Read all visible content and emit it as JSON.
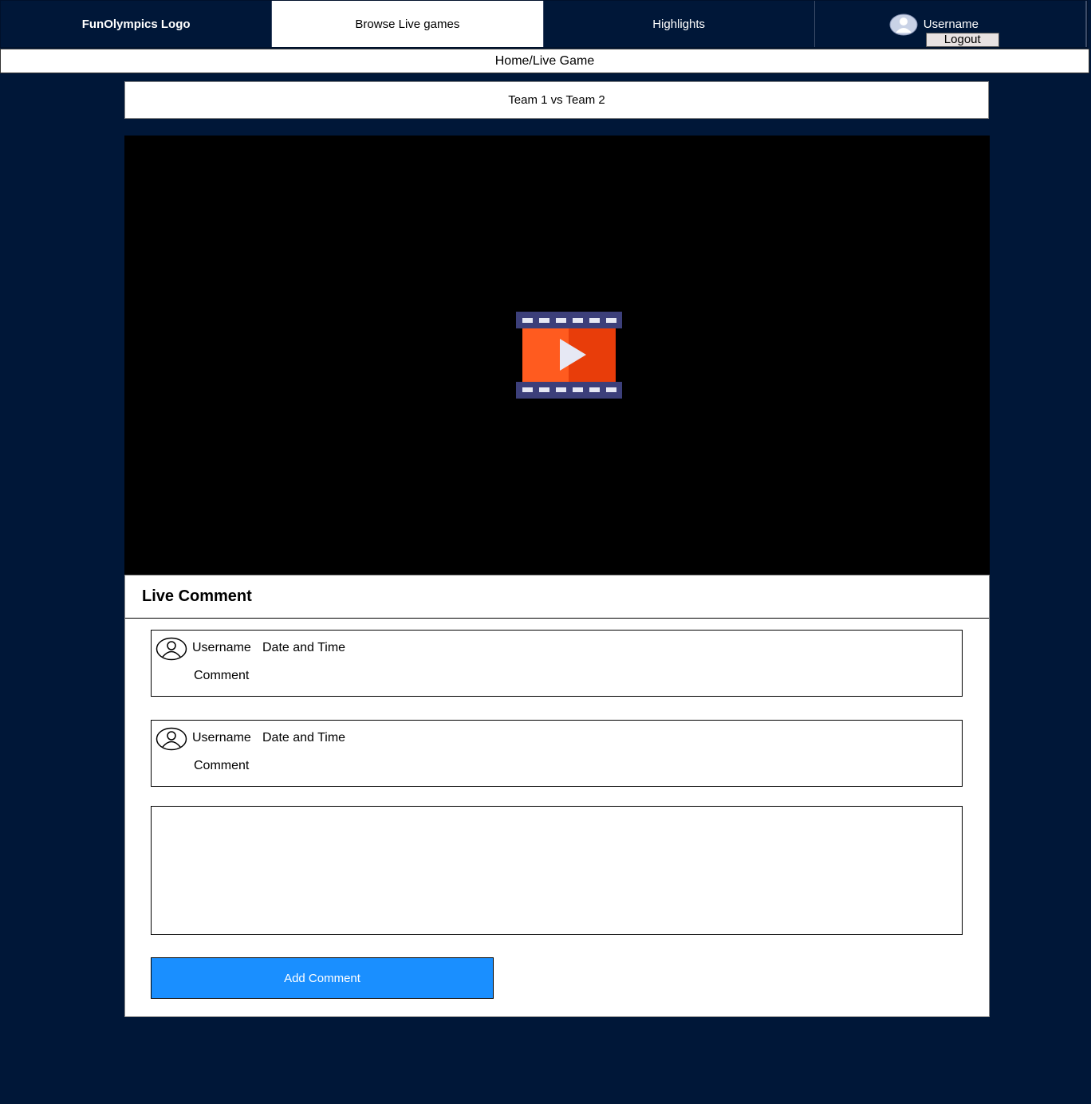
{
  "nav": {
    "logo": "FunOlympics Logo",
    "browse": "Browse Live games",
    "highlights": "Highlights",
    "username": "Username",
    "logout": "Logout"
  },
  "breadcrumb": "Home/Live Game",
  "match": {
    "title": "Team 1 vs Team 2"
  },
  "video": {
    "icon": "video-play-icon"
  },
  "live_comments": {
    "heading": "Live Comment",
    "items": [
      {
        "username": "Username",
        "datetime": "Date and Time",
        "comment": "Comment"
      },
      {
        "username": "Username",
        "datetime": "Date and Time",
        "comment": "Comment"
      }
    ],
    "input_value": "",
    "add_button": "Add Comment"
  },
  "colors": {
    "background": "#001738",
    "button": "#1a8fff",
    "play_orange": "#ff5722",
    "film_strip": "#3c3f7a"
  }
}
